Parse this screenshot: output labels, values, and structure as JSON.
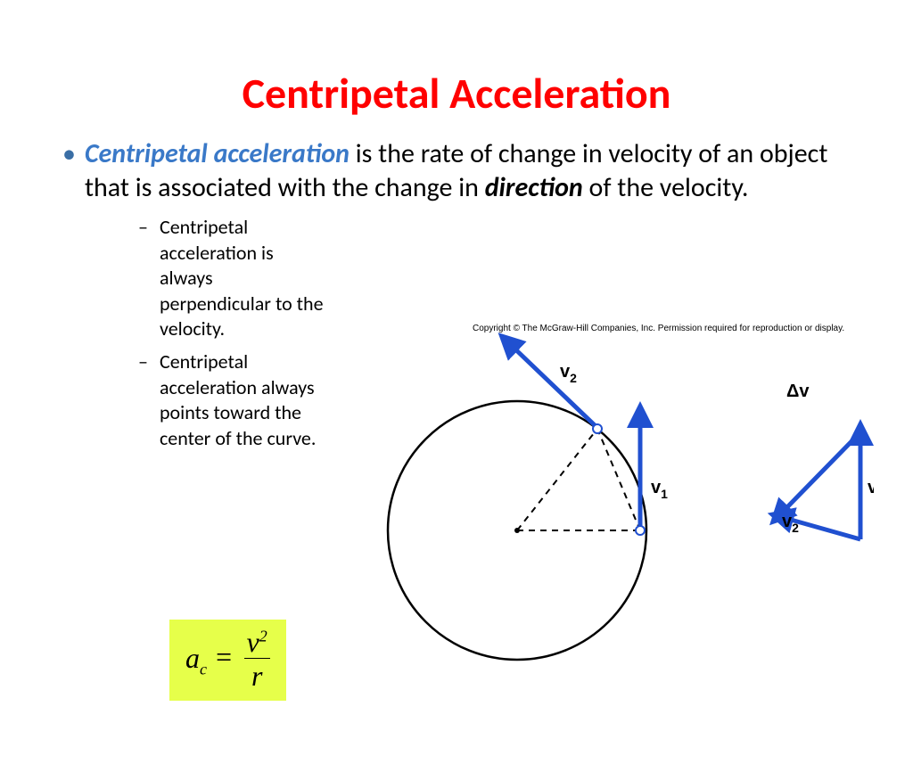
{
  "title": "Centripetal Acceleration",
  "main_bullet": {
    "term": "Centripetal acceleration",
    "text_mid": " is the rate of change in velocity of an object that is associated with the change in ",
    "bold_word": "direction",
    "text_end": " of the velocity."
  },
  "sub_bullets": [
    "Centripetal acceleration is always perpendicular to the velocity.",
    "Centripetal acceleration always points toward the center of the curve."
  ],
  "formula": {
    "lhs_var": "a",
    "lhs_sub": "c",
    "eq": " = ",
    "num_var": "v",
    "num_sup": "2",
    "den_var": "r"
  },
  "labels": {
    "v1": "v",
    "v1_sub": "1",
    "v2": "v",
    "v2_sub": "2",
    "dv_delta": "Δ",
    "dv_v": "v"
  },
  "copyright": "Copyright © The McGraw-Hill Companies, Inc. Permission required for reproduction or display."
}
